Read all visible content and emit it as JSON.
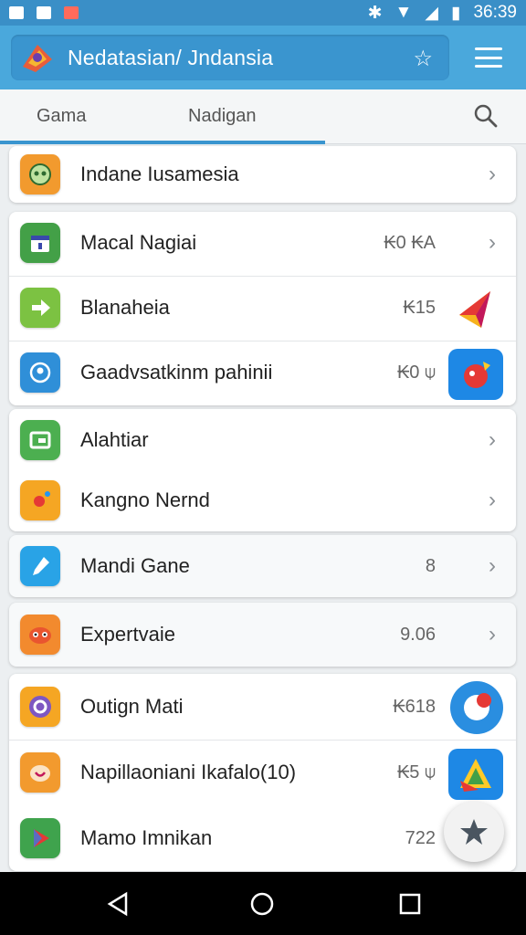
{
  "status_bar": {
    "time": "36:39"
  },
  "toolbar": {
    "title": "Nedatasian/ Jndansia",
    "logo_icon": "app-logo-icon",
    "star_icon": "star-icon",
    "menu_icon": "menu-icon"
  },
  "tabs": [
    {
      "label": "Gama"
    },
    {
      "label": "Nadigan"
    }
  ],
  "search_icon": "search-icon",
  "colors": {
    "status": "#3a8fc7",
    "toolbar": "#4aa8dc",
    "accent": "#3a95cf"
  },
  "items": [
    {
      "label": "Indane Iusamesia",
      "value": "",
      "icon": "robot-icon"
    },
    {
      "label": "Macal Nagiai",
      "value": "₭0 ₭A",
      "icon": "calendar-icon"
    },
    {
      "label": "Blanaheia",
      "value": "₭15",
      "icon": "arrow-right-icon"
    },
    {
      "label": "Gaadvsatkinm pahinii",
      "value": "₭0 ⍦",
      "icon": "location-icon"
    },
    {
      "label": "Alahtiar",
      "value": "",
      "icon": "screen-icon"
    },
    {
      "label": "Kangno Nernd",
      "value": "",
      "icon": "sun-icon"
    },
    {
      "label": "Mandi Gane",
      "value": "8",
      "icon": "pin-icon"
    },
    {
      "label": "Expertvaie",
      "value": "9.06",
      "icon": "face-icon"
    },
    {
      "label": "Outign Mati",
      "value": "₭618",
      "icon": "chat-icon"
    },
    {
      "label": "Napillaoniani Ikafalo(10)",
      "value": "₭5 ⍦",
      "icon": "heart-icon"
    },
    {
      "label": "Mamo Imnikan",
      "value": "722",
      "icon": "play-icon"
    }
  ]
}
